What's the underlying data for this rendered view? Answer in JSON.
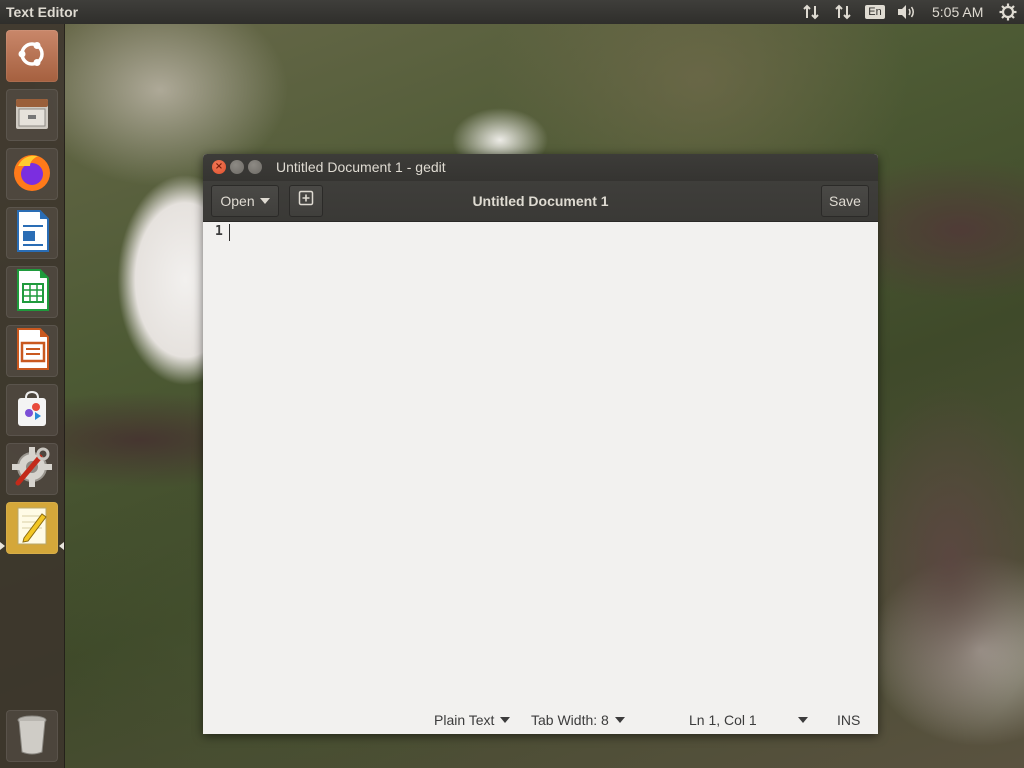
{
  "top_panel": {
    "app_title": "Text Editor",
    "language": "En",
    "clock": "5:05 AM",
    "icons": [
      "network-transfer-icon",
      "network-transfer-icon",
      "volume-icon",
      "system-gear-icon"
    ]
  },
  "launcher": {
    "items": [
      {
        "name": "ubuntu-dash",
        "icon": "ubuntu-logo-icon"
      },
      {
        "name": "files",
        "icon": "file-cabinet-icon"
      },
      {
        "name": "firefox",
        "icon": "firefox-icon"
      },
      {
        "name": "libreoffice-writer",
        "icon": "writer-document-icon"
      },
      {
        "name": "libreoffice-calc",
        "icon": "calc-spreadsheet-icon"
      },
      {
        "name": "libreoffice-impress",
        "icon": "impress-presentation-icon"
      },
      {
        "name": "software",
        "icon": "software-bag-icon"
      },
      {
        "name": "system-settings",
        "icon": "settings-wrench-icon"
      },
      {
        "name": "text-editor",
        "icon": "text-editor-pencil-icon",
        "active": true
      },
      {
        "name": "trash",
        "icon": "trash-icon"
      }
    ]
  },
  "window": {
    "title": "Untitled Document 1 - gedit",
    "headerbar": {
      "open_label": "Open",
      "document_title": "Untitled Document 1",
      "save_label": "Save"
    },
    "editor": {
      "line_number": "1",
      "content": ""
    },
    "statusbar": {
      "language": "Plain Text",
      "tab_width": "Tab Width: 8",
      "position": "Ln 1, Col 1",
      "mode": "INS"
    }
  },
  "colors": {
    "panel": "#2f2e2b",
    "panel_text": "#dfdbd2",
    "close_button": "#e0502d",
    "editor_bg": "#f2f1ef",
    "active_launcher": "#d4a73a"
  }
}
